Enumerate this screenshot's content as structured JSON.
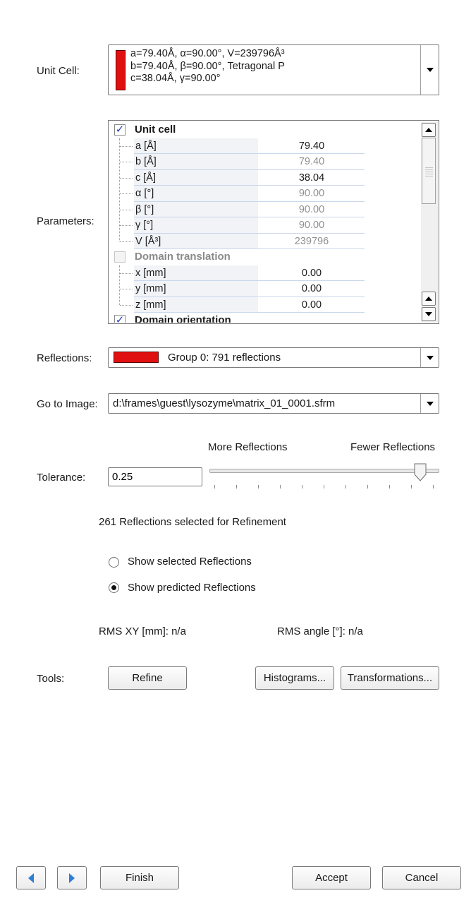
{
  "labels": {
    "unit_cell": "Unit Cell:",
    "parameters": "Parameters:",
    "reflections": "Reflections:",
    "go_to_image": "Go to Image:",
    "tolerance": "Tolerance:",
    "tools": "Tools:"
  },
  "unit_cell_combo": {
    "swatch_color": "#e01010",
    "lines": [
      "a=79.40Å,  α=90.00°,  V=239796Å³",
      "b=79.40Å,  β=90.00°,  Tetragonal P",
      "c=38.04Å,  γ=90.00°"
    ]
  },
  "parameters_grid": {
    "sections": [
      {
        "title": "Unit cell",
        "checked": true,
        "rows": [
          {
            "name": "a [Å]",
            "value": "79.40",
            "readonly": false
          },
          {
            "name": "b [Å]",
            "value": "79.40",
            "readonly": true
          },
          {
            "name": "c [Å]",
            "value": "38.04",
            "readonly": false
          },
          {
            "name": "α [°]",
            "value": "90.00",
            "readonly": true
          },
          {
            "name": "β [°]",
            "value": "90.00",
            "readonly": true
          },
          {
            "name": "γ [°]",
            "value": "90.00",
            "readonly": true
          },
          {
            "name": "V [Å³]",
            "value": "239796",
            "readonly": true
          }
        ]
      },
      {
        "title": "Domain translation",
        "checked": false,
        "rows": [
          {
            "name": "x [mm]",
            "value": "0.00",
            "readonly": false
          },
          {
            "name": "y [mm]",
            "value": "0.00",
            "readonly": false
          },
          {
            "name": "z [mm]",
            "value": "0.00",
            "readonly": false
          }
        ]
      },
      {
        "title": "Domain orientation",
        "checked": true,
        "rows": []
      }
    ]
  },
  "reflections_combo": {
    "swatch_color": "#e01010",
    "text": "Group 0: 791 reflections"
  },
  "image_combo": {
    "text": "d:\\frames\\guest\\lysozyme\\matrix_01_0001.sfrm"
  },
  "tolerance": {
    "value": "0.25",
    "more_label": "More Reflections",
    "fewer_label": "Fewer Reflections",
    "slider_position": 0.94
  },
  "selected_info": "261  Reflections selected for Refinement",
  "radios": {
    "show_selected": "Show selected Reflections",
    "show_predicted": "Show predicted Reflections",
    "checked": "show_predicted"
  },
  "rms": {
    "xy": "RMS XY [mm]:  n/a",
    "angle": "RMS angle [°]:  n/a"
  },
  "tools": {
    "refine": "Refine",
    "histograms": "Histograms...",
    "transformations": "Transformations..."
  },
  "footer": {
    "back_icon": "arrow-left-icon",
    "forward_icon": "arrow-right-icon",
    "finish": "Finish",
    "accept": "Accept",
    "cancel": "Cancel"
  }
}
